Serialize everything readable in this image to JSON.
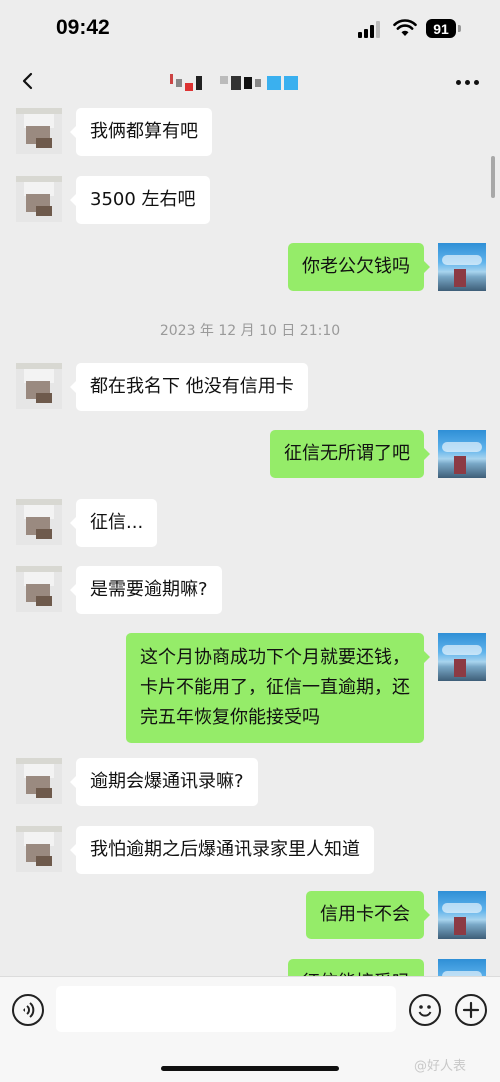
{
  "status_bar": {
    "time": "09:42",
    "battery": "91"
  },
  "nav": {
    "title_blurred": true
  },
  "chat": {
    "timestamp": "2023 年 12 月 10 日 21:10",
    "messages": [
      {
        "side": "left",
        "text": "我俩都算有吧"
      },
      {
        "side": "left",
        "text": "3500 左右吧"
      },
      {
        "side": "right",
        "text": "你老公欠钱吗"
      },
      {
        "side": "left",
        "text": "都在我名下 他没有信用卡"
      },
      {
        "side": "right",
        "text": "征信无所谓了吧"
      },
      {
        "side": "left",
        "text": "征信..."
      },
      {
        "side": "left",
        "text": "是需要逾期嘛?"
      },
      {
        "side": "right",
        "lines": [
          "这个月协商成功下个月就要还钱，",
          "卡片不能用了，征信一直逾期，还",
          "完五年恢复你能接受吗"
        ]
      },
      {
        "side": "left",
        "text": "逾期会爆通讯录嘛?"
      },
      {
        "side": "left",
        "text": "我怕逾期之后爆通讯录家里人知道"
      },
      {
        "side": "right",
        "text": "信用卡不会"
      },
      {
        "side": "right",
        "text": "征信能接受吗"
      }
    ]
  },
  "input_bar": {
    "placeholder": ""
  },
  "watermark": "@好人表",
  "colors": {
    "background": "#ededed",
    "bubble_right": "#95ec69",
    "bubble_left": "#ffffff"
  },
  "icons": {
    "back": "chevron-left-icon",
    "more": "more-dots-icon",
    "voice": "voice-icon",
    "emoji": "emoji-icon",
    "plus": "plus-icon"
  }
}
